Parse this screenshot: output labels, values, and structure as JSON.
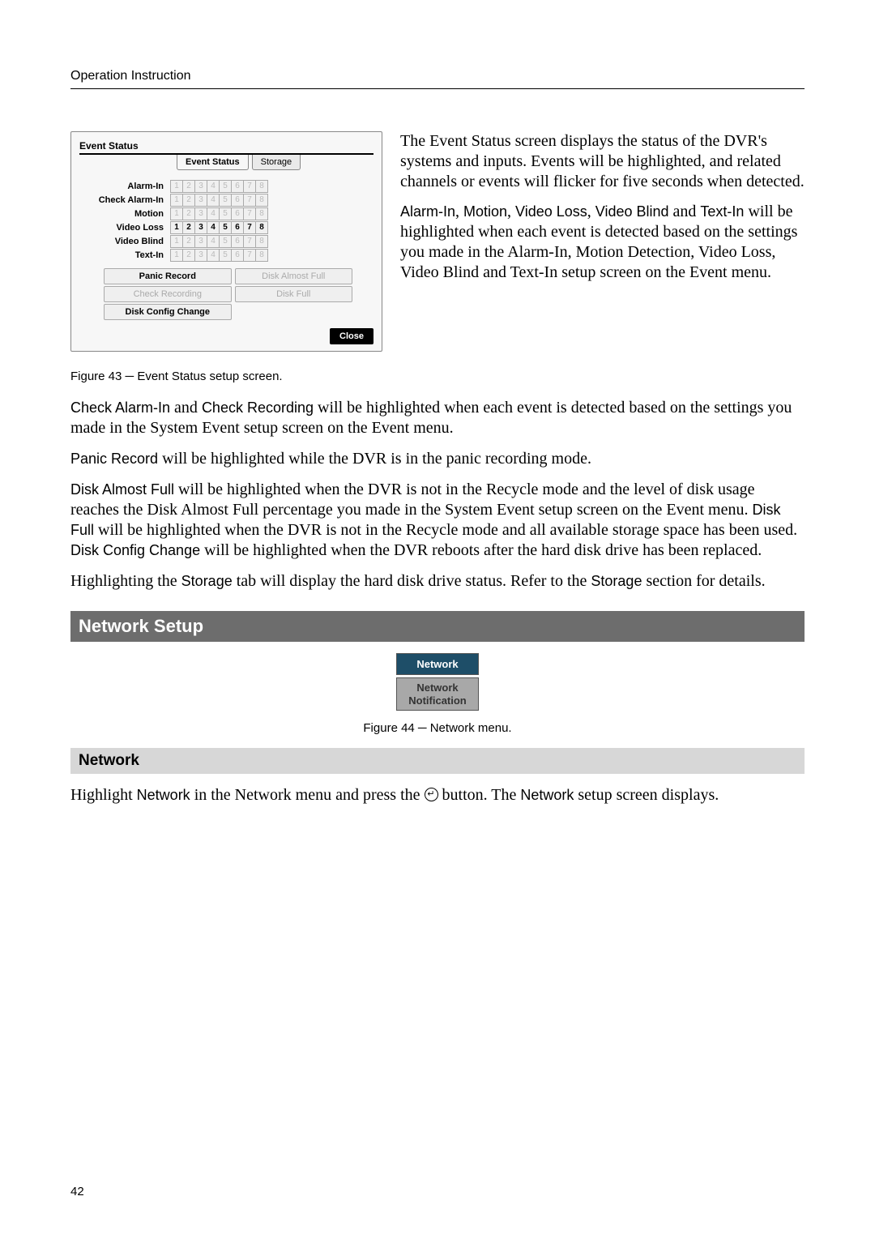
{
  "header": "Operation Instruction",
  "es_panel": {
    "title": "Event Status",
    "tab_event_status": "Event Status",
    "tab_storage": "Storage",
    "rows": [
      {
        "label": "Alarm-In",
        "bold": false
      },
      {
        "label": "Check Alarm-In",
        "bold": false
      },
      {
        "label": "Motion",
        "bold": false
      },
      {
        "label": "Video Loss",
        "bold": true
      },
      {
        "label": "Video Blind",
        "bold": false
      },
      {
        "label": "Text-In",
        "bold": false
      }
    ],
    "channels": [
      "1",
      "2",
      "3",
      "4",
      "5",
      "6",
      "7",
      "8"
    ],
    "pills": {
      "panic_record": "Panic Record",
      "disk_almost_full": "Disk Almost Full",
      "check_recording": "Check Recording",
      "disk_full": "Disk Full",
      "disk_config_change": "Disk Config Change"
    },
    "close": "Close"
  },
  "right_paras": {
    "p1": "The Event Status screen displays the status of the DVR's systems and inputs.  Events will be highlighted, and related channels or events will flicker for five seconds when detected.",
    "p2_alarm": "Alarm-In",
    "p2_comma1": ", ",
    "p2_motion": "Motion",
    "p2_comma2": ", ",
    "p2_videoloss": "Video Loss",
    "p2_comma3": ", ",
    "p2_videoblind": "Video Blind",
    "p2_and": " and ",
    "p2_textin": "Text-In",
    "p2_rest": " will be highlighted when each event is detected based on the settings you made in the Alarm-In, Motion Detection, Video Loss, Video Blind and Text-In setup screen on the Event menu."
  },
  "caption43": "Figure 43 ─ Event Status setup screen.",
  "body": {
    "p_check_alarm": "Check Alarm-In",
    "p_and": " and ",
    "p_check_rec": "Check Recording",
    "p_check_rest": " will be highlighted when each event is detected based on the settings you made in the System Event setup screen on the Event menu.",
    "p_panic": "Panic Record",
    "p_panic_rest": " will be highlighted while the DVR is in the panic recording mode.",
    "p_disk_almost": "Disk Almost Full",
    "p_disk_almost_rest": " will be highlighted when the DVR is not in the Recycle mode and the level of disk usage reaches the Disk Almost Full percentage you made in the System Event setup screen on the Event menu.  ",
    "p_disk_full": "Disk Full",
    "p_disk_full_rest": " will be highlighted when the DVR is not in the Recycle mode and all available storage space has been used.  ",
    "p_disk_config": "Disk Config Change",
    "p_disk_config_rest": " will be highlighted when the DVR reboots after the hard disk drive has been replaced.",
    "p_storage_pre": "Highlighting the ",
    "p_storage_word": "Storage",
    "p_storage_mid": " tab will display the hard disk drive status.  Refer to the ",
    "p_storage_word2": "Storage",
    "p_storage_end": " section for details."
  },
  "section_network_setup": "Network Setup",
  "menu": {
    "network": "Network",
    "notification_l1": "Network",
    "notification_l2": "Notification"
  },
  "caption44": "Figure 44 ─ Network menu.",
  "section_network": "Network",
  "network_para": {
    "pre": "Highlight ",
    "network_word": "Network",
    "mid": " in the Network menu and press the ",
    "ok_glyph": "↵",
    "post": " button.  The ",
    "network_word2": "Network",
    "end": " setup screen displays."
  },
  "page_num": "42"
}
